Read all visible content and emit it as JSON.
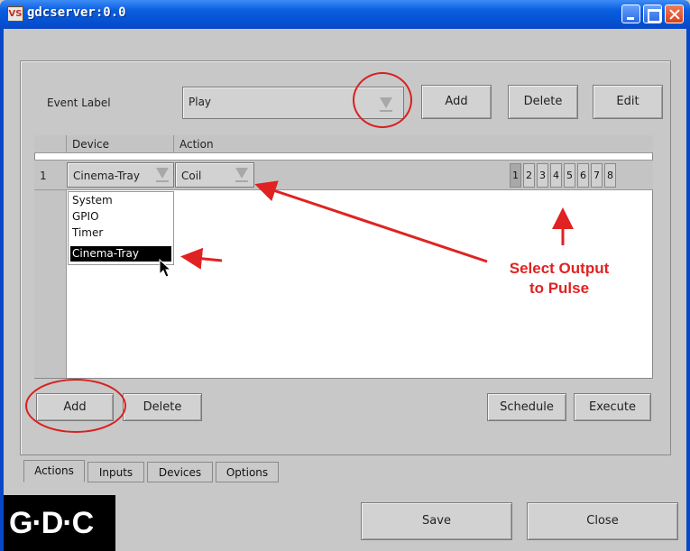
{
  "window": {
    "title": "gdcserver:0.0",
    "icon": "VS"
  },
  "event": {
    "label": "Event Label",
    "value": "Play",
    "add": "Add",
    "delete": "Delete",
    "edit": "Edit"
  },
  "table": {
    "headers": [
      "Device",
      "Action"
    ],
    "rows": [
      {
        "num": "1",
        "device": "Cinema-Tray",
        "action": "Coil"
      }
    ],
    "outputs": [
      "1",
      "2",
      "3",
      "4",
      "5",
      "6",
      "7",
      "8"
    ],
    "selected_output": "1"
  },
  "dropdown": {
    "items": [
      "System",
      "GPIO",
      "Timer",
      "Cinema-Tray"
    ],
    "selected": "Cinema-Tray"
  },
  "bottom_buttons": {
    "add": "Add",
    "delete": "Delete",
    "schedule": "Schedule",
    "execute": "Execute"
  },
  "tabs": [
    "Actions",
    "Inputs",
    "Devices",
    "Options"
  ],
  "active_tab": "Actions",
  "footer": {
    "save": "Save",
    "close": "Close",
    "logo": "G·D·C"
  },
  "annotation": {
    "line1": "Select Output",
    "line2": "to Pulse"
  },
  "colors": {
    "titlebar": "#0553d3",
    "annotation": "#e02222",
    "panel": "#c8c8c8"
  }
}
